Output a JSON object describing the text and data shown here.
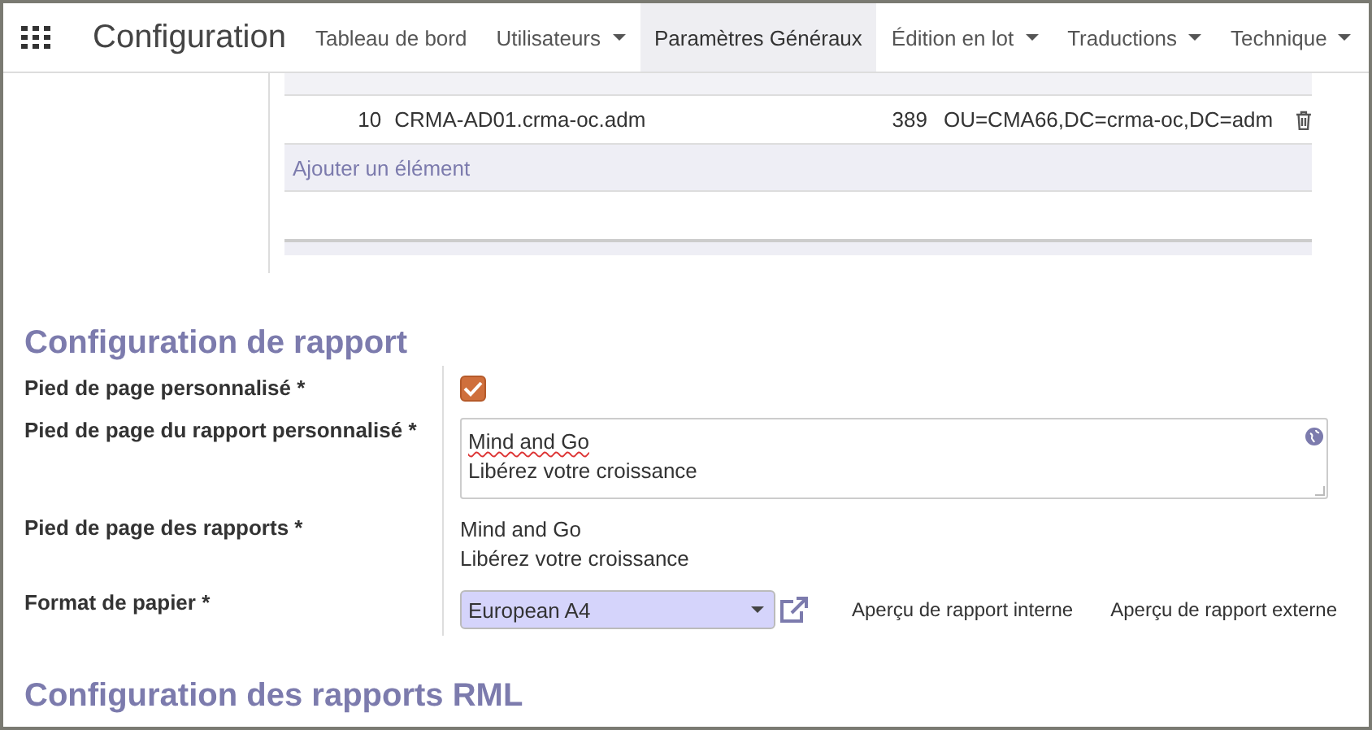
{
  "navbar": {
    "title": "Configuration",
    "menu": [
      {
        "label": "Tableau de bord",
        "dropdown": false,
        "selected": false
      },
      {
        "label": "Utilisateurs",
        "dropdown": true,
        "selected": false
      },
      {
        "label": "Paramètres Généraux",
        "dropdown": false,
        "selected": true
      },
      {
        "label": "Édition en lot",
        "dropdown": true,
        "selected": false
      },
      {
        "label": "Traductions",
        "dropdown": true,
        "selected": false
      },
      {
        "label": "Technique",
        "dropdown": true,
        "selected": false
      }
    ]
  },
  "table": {
    "rows": [
      {
        "column_1": "10",
        "column_2": "CRMA-AD01.crma-oc.adm",
        "column_3": "389",
        "column_4": "OU=CMA66,DC=crma-oc,DC=adm"
      }
    ],
    "add_link": "Ajouter un élément"
  },
  "report_section": {
    "title": "Configuration de rapport",
    "fields": [
      {
        "kind": "checkbox",
        "label": "Pied de page personnalisé *",
        "checked": true
      },
      {
        "kind": "textarea",
        "label": "Pied de page du rapport personnalisé *",
        "lines": [
          "Mind and Go",
          "Libérez votre croissance"
        ]
      },
      {
        "kind": "text",
        "label": "Pied de page des rapports *",
        "lines": [
          "Mind and Go",
          "Libérez votre croissance"
        ]
      },
      {
        "kind": "select",
        "label": "Format de papier *",
        "value": "European A4",
        "links": [
          "Aperçu de rapport interne",
          "Aperçu de rapport externe"
        ]
      }
    ]
  },
  "rml_section": {
    "title": "Configuration des rapports RML"
  }
}
